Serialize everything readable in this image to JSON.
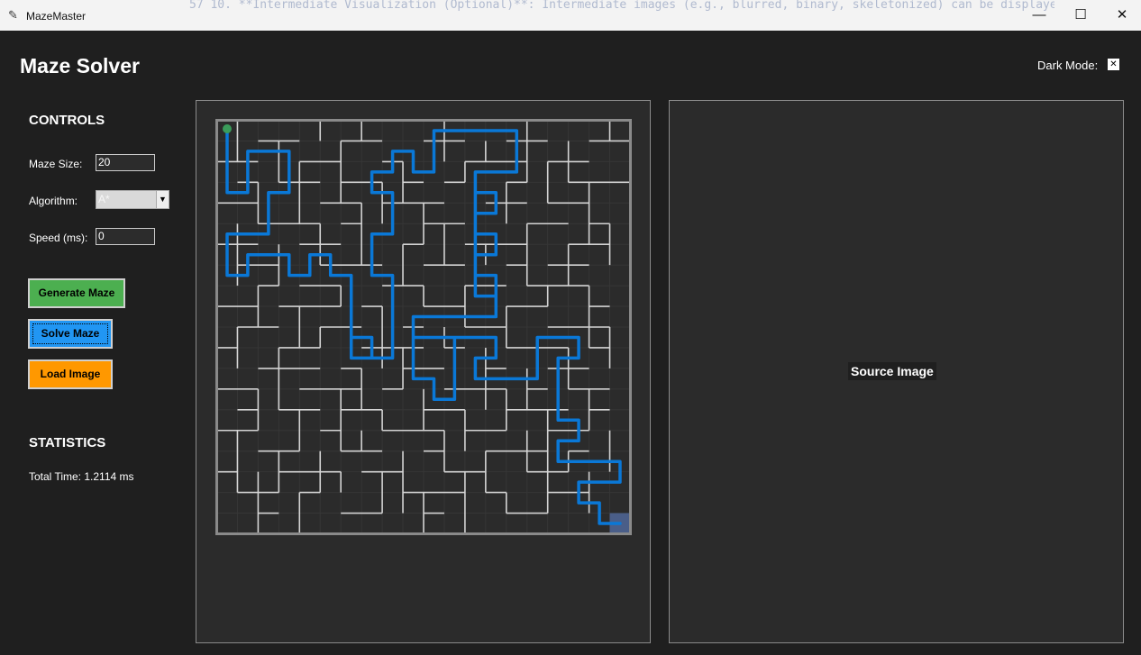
{
  "window": {
    "title": "MazeMaster",
    "background_text": "57  10. **Intermediate Visualization (Optional)**: Intermediate images (e.g., blurred, binary, skeletonized) can be displayed",
    "minimize": "—",
    "maximize": "☐",
    "close": "✕"
  },
  "header": {
    "title": "Maze Solver",
    "dark_mode_label": "Dark Mode:",
    "dark_mode_checked": true,
    "dark_mode_mark": "✕"
  },
  "controls": {
    "title": "CONTROLS",
    "maze_size_label": "Maze Size:",
    "maze_size_value": "20",
    "algorithm_label": "Algorithm:",
    "algorithm_value": "A*",
    "speed_label": "Speed (ms):",
    "speed_value": "0",
    "generate_label": "Generate Maze",
    "solve_label": "Solve Maze",
    "load_label": "Load Image"
  },
  "statistics": {
    "title": "STATISTICS",
    "total_time": "Total Time: 1.2114 ms"
  },
  "source_panel": {
    "label": "Source Image"
  },
  "maze": {
    "grid_size": 20,
    "colors": {
      "background": "#2b2b2b",
      "cell_line": "#363636",
      "wall": "#d4d4d4",
      "border": "#8a8a8a",
      "path": "#0a78d7",
      "start": "#3a9c5a",
      "goal": "#4a5e88"
    },
    "start_cell": [
      0,
      0
    ],
    "goal_cell": [
      19,
      19
    ],
    "path": [
      [
        0,
        0
      ],
      [
        0,
        1
      ],
      [
        0,
        2
      ],
      [
        0,
        3
      ],
      [
        1,
        3
      ],
      [
        1,
        2
      ],
      [
        1,
        1
      ],
      [
        2,
        1
      ],
      [
        3,
        1
      ],
      [
        3,
        2
      ],
      [
        3,
        3
      ],
      [
        2,
        3
      ],
      [
        2,
        4
      ],
      [
        2,
        5
      ],
      [
        1,
        5
      ],
      [
        0,
        5
      ],
      [
        0,
        6
      ],
      [
        0,
        7
      ],
      [
        1,
        7
      ],
      [
        1,
        6
      ],
      [
        2,
        6
      ],
      [
        3,
        6
      ],
      [
        3,
        7
      ],
      [
        4,
        7
      ],
      [
        4,
        6
      ],
      [
        5,
        6
      ],
      [
        5,
        7
      ],
      [
        6,
        7
      ],
      [
        6,
        8
      ],
      [
        6,
        9
      ],
      [
        6,
        10
      ],
      [
        6,
        11
      ],
      [
        7,
        11
      ],
      [
        7,
        10
      ],
      [
        6,
        10
      ],
      [
        6,
        11
      ],
      [
        7,
        11
      ],
      [
        8,
        11
      ],
      [
        8,
        10
      ],
      [
        8,
        9
      ],
      [
        8,
        8
      ],
      [
        8,
        7
      ],
      [
        7,
        7
      ],
      [
        7,
        6
      ],
      [
        7,
        5
      ],
      [
        8,
        5
      ],
      [
        8,
        4
      ],
      [
        8,
        3
      ],
      [
        7,
        3
      ],
      [
        7,
        2
      ],
      [
        8,
        2
      ],
      [
        8,
        1
      ],
      [
        9,
        1
      ],
      [
        9,
        2
      ],
      [
        10,
        2
      ],
      [
        10,
        1
      ],
      [
        10,
        0
      ],
      [
        11,
        0
      ],
      [
        12,
        0
      ],
      [
        13,
        0
      ],
      [
        14,
        0
      ],
      [
        14,
        1
      ],
      [
        14,
        2
      ],
      [
        13,
        2
      ],
      [
        12,
        2
      ],
      [
        12,
        3
      ],
      [
        12,
        4
      ],
      [
        12,
        5
      ],
      [
        12,
        6
      ],
      [
        12,
        7
      ],
      [
        12,
        8
      ],
      [
        13,
        8
      ],
      [
        13,
        7
      ],
      [
        12,
        7
      ],
      [
        12,
        6
      ],
      [
        13,
        6
      ],
      [
        13,
        5
      ],
      [
        12,
        5
      ],
      [
        12,
        4
      ],
      [
        13,
        4
      ],
      [
        13,
        3
      ],
      [
        12,
        3
      ],
      [
        12,
        4
      ],
      [
        12,
        5
      ],
      [
        13,
        5
      ],
      [
        13,
        6
      ],
      [
        12,
        6
      ],
      [
        12,
        7
      ],
      [
        13,
        7
      ],
      [
        13,
        8
      ],
      [
        13,
        9
      ],
      [
        12,
        9
      ],
      [
        11,
        9
      ],
      [
        10,
        9
      ],
      [
        9,
        9
      ],
      [
        9,
        10
      ],
      [
        10,
        10
      ],
      [
        11,
        10
      ],
      [
        10,
        10
      ],
      [
        9,
        10
      ],
      [
        9,
        11
      ],
      [
        9,
        12
      ],
      [
        10,
        12
      ],
      [
        10,
        13
      ],
      [
        11,
        13
      ],
      [
        11,
        12
      ],
      [
        11,
        11
      ],
      [
        11,
        10
      ],
      [
        12,
        10
      ],
      [
        13,
        10
      ],
      [
        13,
        11
      ],
      [
        12,
        11
      ],
      [
        12,
        12
      ],
      [
        13,
        12
      ],
      [
        14,
        12
      ],
      [
        15,
        12
      ],
      [
        15,
        11
      ],
      [
        15,
        10
      ],
      [
        16,
        10
      ],
      [
        17,
        10
      ],
      [
        17,
        11
      ],
      [
        16,
        11
      ],
      [
        16,
        12
      ],
      [
        16,
        13
      ],
      [
        16,
        14
      ],
      [
        17,
        14
      ],
      [
        17,
        15
      ],
      [
        16,
        15
      ],
      [
        16,
        16
      ],
      [
        17,
        16
      ],
      [
        18,
        16
      ],
      [
        19,
        16
      ],
      [
        19,
        17
      ],
      [
        18,
        17
      ],
      [
        17,
        17
      ],
      [
        17,
        18
      ],
      [
        18,
        18
      ],
      [
        18,
        19
      ],
      [
        19,
        19
      ]
    ],
    "walls_h": [
      [
        1,
        0,
        3
      ],
      [
        5,
        0,
        2
      ],
      [
        8,
        0,
        3
      ],
      [
        11,
        0,
        1
      ],
      [
        15,
        0,
        1
      ],
      [
        17,
        0,
        2
      ],
      [
        2,
        1,
        2
      ],
      [
        6,
        1,
        2
      ],
      [
        10,
        1,
        2
      ],
      [
        14,
        1,
        2
      ],
      [
        18,
        1,
        2
      ],
      [
        0,
        2,
        2
      ],
      [
        4,
        2,
        2
      ],
      [
        8,
        2,
        1
      ],
      [
        12,
        2,
        3
      ],
      [
        16,
        2,
        2
      ],
      [
        1,
        3,
        1
      ],
      [
        3,
        3,
        2
      ],
      [
        6,
        3,
        2
      ],
      [
        9,
        3,
        1
      ],
      [
        11,
        3,
        1
      ],
      [
        14,
        3,
        1
      ],
      [
        17,
        3,
        3
      ],
      [
        0,
        4,
        2
      ],
      [
        5,
        4,
        2
      ],
      [
        8,
        4,
        3
      ],
      [
        13,
        4,
        2
      ],
      [
        16,
        4,
        2
      ],
      [
        2,
        5,
        3
      ],
      [
        6,
        5,
        1
      ],
      [
        10,
        5,
        2
      ],
      [
        15,
        5,
        2
      ],
      [
        18,
        5,
        1
      ],
      [
        0,
        6,
        2
      ],
      [
        4,
        6,
        2
      ],
      [
        9,
        6,
        1
      ],
      [
        12,
        6,
        3
      ],
      [
        17,
        6,
        2
      ],
      [
        1,
        7,
        2
      ],
      [
        5,
        7,
        3
      ],
      [
        10,
        7,
        2
      ],
      [
        14,
        7,
        1
      ],
      [
        16,
        7,
        2
      ],
      [
        2,
        8,
        1
      ],
      [
        4,
        8,
        2
      ],
      [
        8,
        8,
        2
      ],
      [
        12,
        8,
        2
      ],
      [
        15,
        8,
        3
      ],
      [
        0,
        9,
        2
      ],
      [
        3,
        9,
        3
      ],
      [
        7,
        9,
        1
      ],
      [
        10,
        9,
        2
      ],
      [
        14,
        9,
        2
      ],
      [
        18,
        9,
        1
      ],
      [
        1,
        10,
        2
      ],
      [
        5,
        10,
        2
      ],
      [
        9,
        10,
        1
      ],
      [
        12,
        10,
        2
      ],
      [
        16,
        10,
        3
      ],
      [
        0,
        11,
        1
      ],
      [
        3,
        11,
        2
      ],
      [
        7,
        11,
        3
      ],
      [
        11,
        11,
        1
      ],
      [
        14,
        11,
        3
      ],
      [
        18,
        11,
        1
      ],
      [
        2,
        12,
        3
      ],
      [
        6,
        12,
        1
      ],
      [
        9,
        12,
        2
      ],
      [
        13,
        12,
        1
      ],
      [
        16,
        12,
        2
      ],
      [
        0,
        13,
        2
      ],
      [
        4,
        13,
        3
      ],
      [
        8,
        13,
        1
      ],
      [
        11,
        13,
        3
      ],
      [
        15,
        13,
        1
      ],
      [
        17,
        13,
        2
      ],
      [
        1,
        14,
        1
      ],
      [
        3,
        14,
        2
      ],
      [
        6,
        14,
        2
      ],
      [
        10,
        14,
        2
      ],
      [
        14,
        14,
        3
      ],
      [
        18,
        14,
        1
      ],
      [
        0,
        15,
        2
      ],
      [
        5,
        15,
        1
      ],
      [
        8,
        15,
        3
      ],
      [
        12,
        15,
        2
      ],
      [
        16,
        15,
        2
      ],
      [
        2,
        16,
        2
      ],
      [
        6,
        16,
        2
      ],
      [
        10,
        16,
        1
      ],
      [
        13,
        16,
        3
      ],
      [
        17,
        16,
        1
      ],
      [
        0,
        17,
        1
      ],
      [
        3,
        17,
        3
      ],
      [
        7,
        17,
        2
      ],
      [
        11,
        17,
        2
      ],
      [
        15,
        17,
        2
      ],
      [
        1,
        18,
        2
      ],
      [
        4,
        18,
        1
      ],
      [
        9,
        18,
        3
      ],
      [
        13,
        18,
        1
      ],
      [
        16,
        18,
        2
      ],
      [
        2,
        19,
        1
      ],
      [
        6,
        19,
        2
      ],
      [
        10,
        19,
        1
      ],
      [
        14,
        19,
        2
      ]
    ],
    "walls_v": [
      [
        1,
        0,
        2
      ],
      [
        3,
        1,
        2
      ],
      [
        5,
        0,
        1
      ],
      [
        6,
        1,
        3
      ],
      [
        7,
        0,
        1
      ],
      [
        9,
        2,
        2
      ],
      [
        11,
        0,
        2
      ],
      [
        13,
        1,
        1
      ],
      [
        15,
        0,
        3
      ],
      [
        17,
        1,
        2
      ],
      [
        19,
        0,
        1
      ],
      [
        2,
        3,
        2
      ],
      [
        4,
        2,
        3
      ],
      [
        8,
        3,
        2
      ],
      [
        10,
        4,
        2
      ],
      [
        12,
        2,
        1
      ],
      [
        14,
        3,
        2
      ],
      [
        16,
        2,
        2
      ],
      [
        18,
        3,
        3
      ],
      [
        1,
        5,
        3
      ],
      [
        3,
        6,
        2
      ],
      [
        5,
        5,
        2
      ],
      [
        7,
        4,
        3
      ],
      [
        9,
        6,
        2
      ],
      [
        11,
        5,
        2
      ],
      [
        13,
        6,
        1
      ],
      [
        15,
        5,
        3
      ],
      [
        17,
        6,
        2
      ],
      [
        19,
        5,
        2
      ],
      [
        2,
        8,
        2
      ],
      [
        4,
        9,
        2
      ],
      [
        6,
        8,
        1
      ],
      [
        8,
        9,
        3
      ],
      [
        10,
        8,
        1
      ],
      [
        12,
        8,
        2
      ],
      [
        14,
        9,
        2
      ],
      [
        16,
        8,
        1
      ],
      [
        18,
        8,
        3
      ],
      [
        1,
        10,
        2
      ],
      [
        3,
        11,
        3
      ],
      [
        5,
        10,
        1
      ],
      [
        7,
        12,
        2
      ],
      [
        9,
        11,
        2
      ],
      [
        11,
        10,
        1
      ],
      [
        13,
        11,
        3
      ],
      [
        15,
        12,
        2
      ],
      [
        17,
        11,
        2
      ],
      [
        19,
        10,
        2
      ],
      [
        2,
        13,
        2
      ],
      [
        4,
        14,
        2
      ],
      [
        6,
        13,
        3
      ],
      [
        8,
        14,
        1
      ],
      [
        10,
        13,
        2
      ],
      [
        12,
        14,
        2
      ],
      [
        14,
        13,
        2
      ],
      [
        16,
        14,
        3
      ],
      [
        18,
        13,
        2
      ],
      [
        1,
        15,
        3
      ],
      [
        3,
        16,
        2
      ],
      [
        5,
        16,
        2
      ],
      [
        7,
        15,
        1
      ],
      [
        9,
        16,
        3
      ],
      [
        11,
        15,
        2
      ],
      [
        13,
        16,
        2
      ],
      [
        15,
        15,
        2
      ],
      [
        17,
        16,
        1
      ],
      [
        19,
        15,
        2
      ],
      [
        2,
        17,
        3
      ],
      [
        4,
        18,
        2
      ],
      [
        6,
        17,
        1
      ],
      [
        8,
        17,
        2
      ],
      [
        10,
        18,
        2
      ],
      [
        12,
        17,
        3
      ],
      [
        14,
        18,
        1
      ],
      [
        16,
        17,
        2
      ],
      [
        18,
        17,
        2
      ]
    ]
  }
}
